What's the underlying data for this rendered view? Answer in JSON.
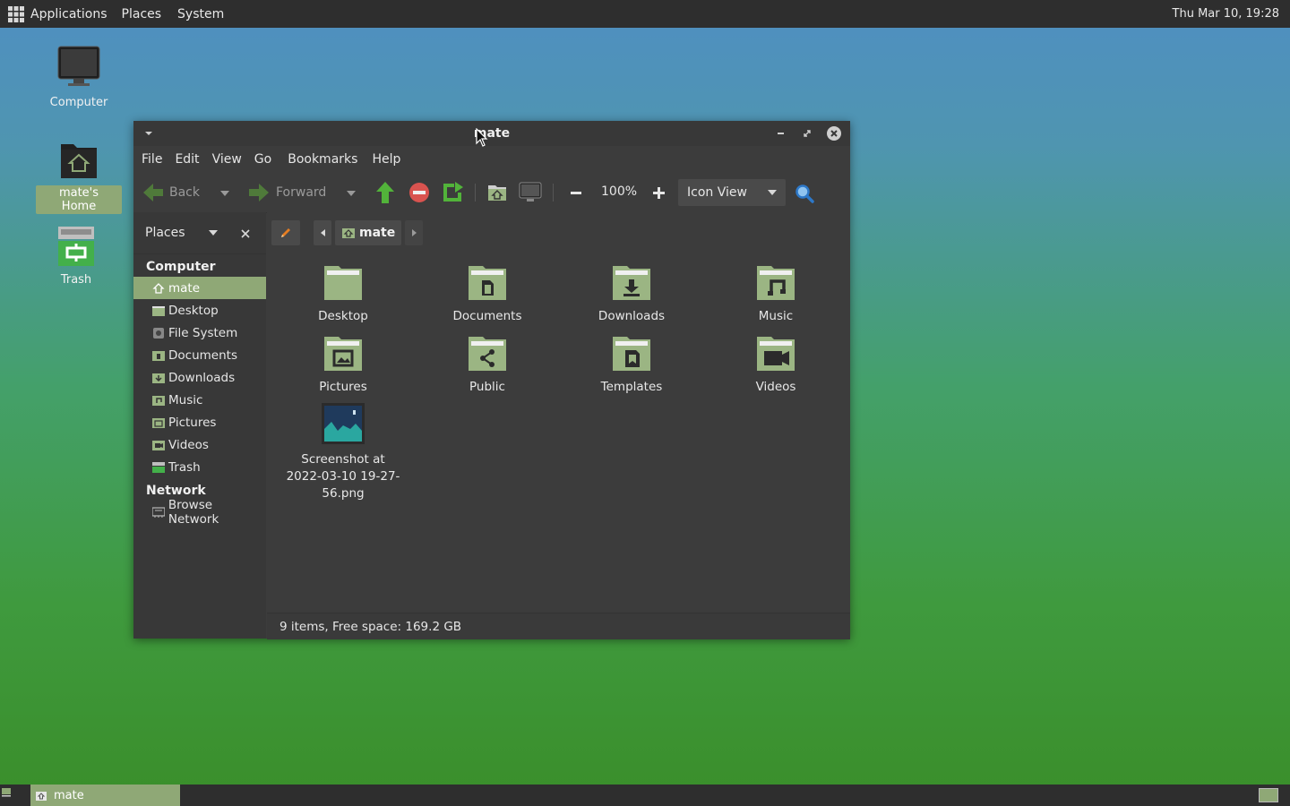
{
  "top_panel": {
    "menus": [
      "Applications",
      "Places",
      "System"
    ],
    "clock": "Thu Mar 10, 19:28"
  },
  "desktop": {
    "icons": [
      {
        "label": "Computer"
      },
      {
        "label": "mate's Home"
      },
      {
        "label": "Trash"
      }
    ]
  },
  "window": {
    "title": "mate",
    "menus": [
      "File",
      "Edit",
      "View",
      "Go",
      "Bookmarks",
      "Help"
    ],
    "toolbar": {
      "back": "Back",
      "forward": "Forward",
      "zoom": "100%",
      "view_mode": "Icon View"
    },
    "sidebar": {
      "header": "Places",
      "sections": [
        {
          "title": "Computer",
          "items": [
            "mate",
            "Desktop",
            "File System",
            "Documents",
            "Downloads",
            "Music",
            "Pictures",
            "Videos",
            "Trash"
          ]
        },
        {
          "title": "Network",
          "items": [
            "Browse Network"
          ]
        }
      ]
    },
    "location": {
      "current": "mate"
    },
    "files": [
      {
        "name": "Desktop",
        "icon": "folder-icon"
      },
      {
        "name": "Documents",
        "icon": "folder-documents-icon"
      },
      {
        "name": "Downloads",
        "icon": "folder-downloads-icon"
      },
      {
        "name": "Music",
        "icon": "folder-music-icon"
      },
      {
        "name": "Pictures",
        "icon": "folder-pictures-icon"
      },
      {
        "name": "Public",
        "icon": "folder-public-icon"
      },
      {
        "name": "Templates",
        "icon": "folder-templates-icon"
      },
      {
        "name": "Videos",
        "icon": "folder-videos-icon"
      },
      {
        "name": "Screenshot at 2022-03-10 19-27-56.png",
        "icon": "image-file-icon"
      }
    ],
    "status": "9 items, Free space: 169.2 GB"
  },
  "bottom_panel": {
    "task": "mate"
  },
  "colors": {
    "accent": "#8fa876",
    "folder": "#9bb583",
    "toolbar_green": "#52b33a",
    "stop_red": "#d9534f"
  }
}
